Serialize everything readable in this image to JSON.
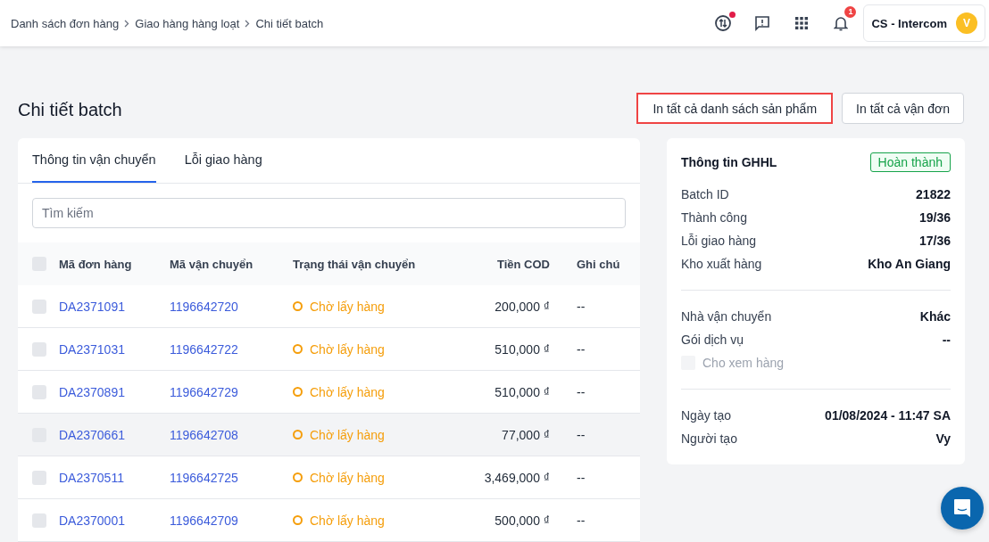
{
  "breadcrumb": [
    {
      "label": "Danh sách đơn hàng"
    },
    {
      "label": "Giao hàng hàng loạt"
    },
    {
      "label": "Chi tiết batch"
    }
  ],
  "header": {
    "notification_count": "1",
    "account": "CS - Intercom",
    "avatar_initial": "V"
  },
  "page": {
    "title": "Chi tiết batch"
  },
  "actions": [
    {
      "label": "In tất cả danh sách sản phẩm",
      "highlighted": true
    },
    {
      "label": "In tất cả vận đơn",
      "highlighted": false
    }
  ],
  "tabs": [
    {
      "label": "Thông tin vận chuyển",
      "selected": true
    },
    {
      "label": "Lỗi giao hàng",
      "selected": false
    }
  ],
  "search": {
    "placeholder": "Tìm kiếm"
  },
  "table": {
    "select_all_checked": false,
    "columns": [
      "Mã đơn hàng",
      "Mã vận chuyển",
      "Trạng thái vận chuyển",
      "Tiền COD",
      "Ghi chú"
    ],
    "rows": [
      {
        "order": "DA2371091",
        "tracking": "1196642720",
        "status": "Chờ lấy hàng",
        "cod": "200,000 ₫",
        "note": "--",
        "checked": false,
        "highlighted": false
      },
      {
        "order": "DA2371031",
        "tracking": "1196642722",
        "status": "Chờ lấy hàng",
        "cod": "510,000 ₫",
        "note": "--",
        "checked": false,
        "highlighted": false
      },
      {
        "order": "DA2370891",
        "tracking": "1196642729",
        "status": "Chờ lấy hàng",
        "cod": "510,000 ₫",
        "note": "--",
        "checked": false,
        "highlighted": false
      },
      {
        "order": "DA2370661",
        "tracking": "1196642708",
        "status": "Chờ lấy hàng",
        "cod": "77,000 ₫",
        "note": "--",
        "checked": false,
        "highlighted": true
      },
      {
        "order": "DA2370511",
        "tracking": "1196642725",
        "status": "Chờ lấy hàng",
        "cod": "3,469,000 ₫",
        "note": "--",
        "checked": false,
        "highlighted": false
      },
      {
        "order": "DA2370001",
        "tracking": "1196642709",
        "status": "Chờ lấy hàng",
        "cod": "500,000 ₫",
        "note": "--",
        "checked": false,
        "highlighted": false
      }
    ]
  },
  "info": {
    "title": "Thông tin GHHL",
    "status": "Hoàn thành",
    "groups": [
      [
        {
          "kind": "field",
          "label": "Batch ID",
          "value": "21822"
        },
        {
          "kind": "field",
          "label": "Thành công",
          "value": "19/36"
        },
        {
          "kind": "field",
          "label": "Lỗi giao hàng",
          "value": "17/36"
        },
        {
          "kind": "field",
          "label": "Kho xuất hàng",
          "value": "Kho An Giang"
        }
      ],
      [
        {
          "kind": "field",
          "label": "Nhà vận chuyển",
          "value": "Khác"
        },
        {
          "kind": "field",
          "label": "Gói dịch vụ",
          "value": "--"
        },
        {
          "kind": "checkbox",
          "label": "Cho xem hàng",
          "checked": false,
          "disabled": true
        }
      ],
      [
        {
          "kind": "field",
          "label": "Ngày tạo",
          "value": "01/08/2024 - 11:47 SA"
        },
        {
          "kind": "field",
          "label": "Người tạo",
          "value": "Vy"
        }
      ]
    ]
  }
}
